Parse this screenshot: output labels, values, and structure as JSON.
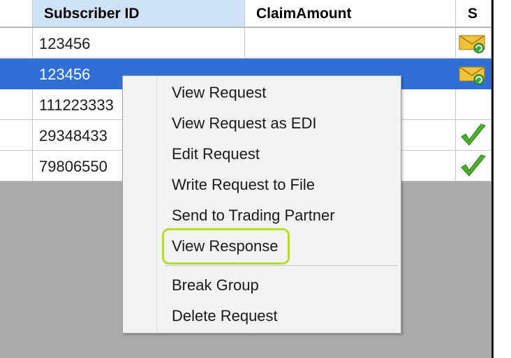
{
  "grid": {
    "columns": [
      {
        "label": "",
        "selected": false
      },
      {
        "label": "Subscriber ID",
        "selected": true
      },
      {
        "label": "ClaimAmount",
        "selected": false
      },
      {
        "label": "S",
        "selected": false
      }
    ],
    "rows": [
      {
        "subscriber_id": "123456",
        "claim_amount": "",
        "status_icon": "envelope-refresh-icon",
        "selected": false
      },
      {
        "subscriber_id": "123456",
        "claim_amount": "",
        "status_icon": "envelope-refresh-icon",
        "selected": true
      },
      {
        "subscriber_id": "111223333",
        "claim_amount": "",
        "status_icon": "",
        "selected": false
      },
      {
        "subscriber_id": "29348433",
        "claim_amount": "",
        "status_icon": "checkmark-icon",
        "selected": false
      },
      {
        "subscriber_id": "79806550",
        "claim_amount": "",
        "status_icon": "checkmark-icon",
        "selected": false
      }
    ]
  },
  "context_menu": {
    "items": [
      {
        "label": "View Request"
      },
      {
        "label": "View Request as EDI"
      },
      {
        "label": "Edit Request"
      },
      {
        "label": "Write Request to File"
      },
      {
        "label": "Send to Trading Partner"
      },
      {
        "label": "View Response",
        "highlighted": true
      },
      {
        "label": "Break Group"
      },
      {
        "label": "Delete Request"
      }
    ]
  },
  "colors": {
    "selection": "#2f6fd6",
    "header_selected": "#cfe3f7",
    "highlight_outline": "#b6dd2b",
    "check_green": "#4caf2e"
  }
}
